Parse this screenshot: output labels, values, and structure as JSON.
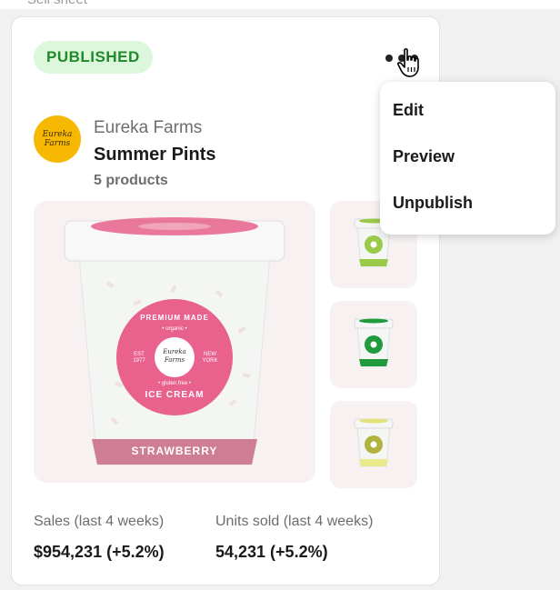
{
  "header": {
    "cut_label": "Sell sheet"
  },
  "card": {
    "status_badge": "PUBLISHED",
    "brand": {
      "name": "Eureka Farms",
      "logo_text_line1": "Eureka",
      "logo_text_line2": "Farms",
      "logo_color": "#f6b800"
    },
    "product_title": "Summer Pints",
    "product_count": "5 products",
    "hero_image": {
      "label": "STRAWBERRY",
      "circle_top_text": "PREMIUM MADE",
      "circle_organic": "• organic •",
      "circle_est": "EST 1977",
      "circle_ny": "NEW YORK",
      "circle_logo_line1": "Eureka",
      "circle_logo_line2": "Farms",
      "circle_gluten": "• gluten free •",
      "circle_bottom_text": "ICE CREAM",
      "accent_color": "#e8628d",
      "band_color": "#cf7d95"
    },
    "thumbnails": [
      {
        "name": "lime",
        "color": "#9bc94a"
      },
      {
        "name": "mint",
        "color": "#1f9a3c"
      },
      {
        "name": "vanilla",
        "color": "#b2b33f"
      }
    ],
    "stats": [
      {
        "label": "Sales (last 4 weeks)",
        "value": "$954,231 (+5.2%)"
      },
      {
        "label": "Units sold (last 4 weeks)",
        "value": "54,231 (+5.2%)"
      }
    ]
  },
  "menu": {
    "items": [
      {
        "label": "Edit"
      },
      {
        "label": "Preview"
      },
      {
        "label": "Unpublish"
      }
    ]
  },
  "icons": {
    "more": "more-horizontal-icon",
    "cursor": "hand-pointer-icon"
  }
}
